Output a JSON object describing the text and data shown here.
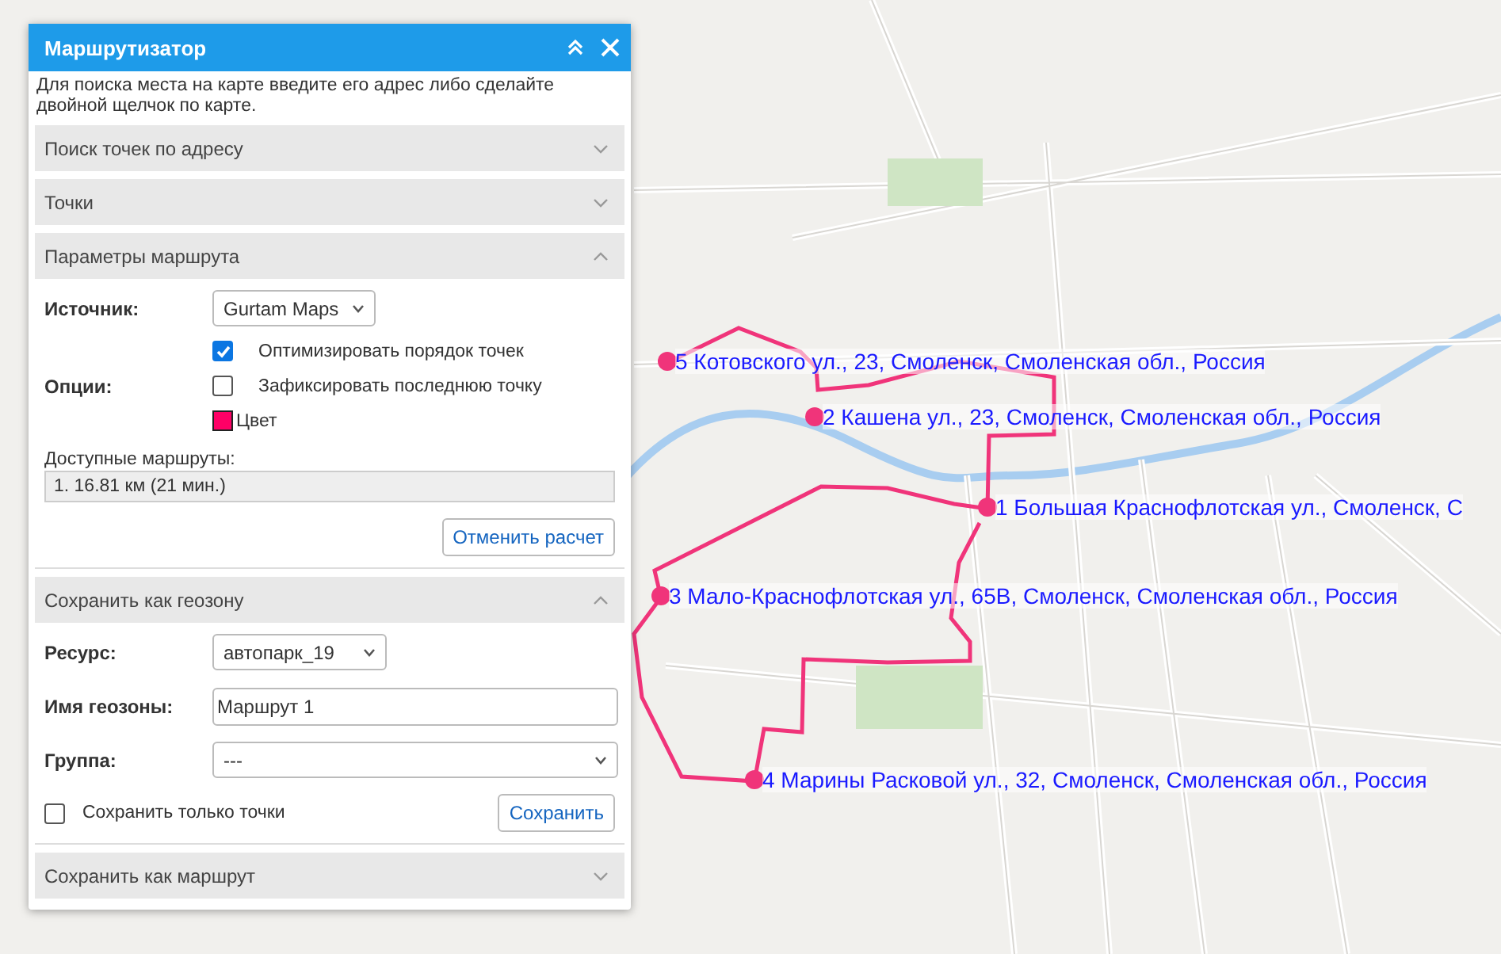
{
  "map": {
    "markers": [
      {
        "label": "5 Котовского ул., 23, Смоленск, Смоленская обл., Россия"
      },
      {
        "label": "2 Кашена ул., 23, Смоленск, Смоленская обл., Россия"
      },
      {
        "label": "1 Большая Краснофлотская ул., Смоленск, С"
      },
      {
        "label": "3 Мало-Краснофлотская ул., 65В, Смоленск, Смоленская обл., Россия"
      },
      {
        "label": "4 Марины Расковой ул., 32, Смоленск, Смоленская обл., Россия"
      }
    ]
  },
  "panel": {
    "title": "Маршрутизатор",
    "hint": "Для поиска места на карте введите его адрес либо сделайте двойной щелчок по карте.",
    "sections": [
      {
        "kind": "address_search",
        "title": "Поиск точек по адресу",
        "expanded": false
      },
      {
        "kind": "points",
        "title": "Точки",
        "expanded": false
      },
      {
        "kind": "route_params",
        "title": "Параметры маршрута",
        "expanded": true,
        "source_label": "Источник:",
        "source_value": "Gurtam Maps",
        "options_label": "Опции:",
        "options": [
          {
            "label": "Оптимизировать порядок точек",
            "checked": true
          },
          {
            "label": "Зафиксировать последнюю точку",
            "checked": false
          }
        ],
        "color_label": "Цвет",
        "color": "#ff0066",
        "routes_label": "Доступные маршруты:",
        "routes": [
          "1. 16.81 км (21 мин.)"
        ],
        "cancel_button": "Отменить расчет"
      },
      {
        "kind": "geofence",
        "title": "Сохранить как геозону",
        "expanded": true,
        "resource_label": "Ресурс:",
        "resource_value": "автопарк_19",
        "name_label": "Имя геозоны:",
        "name_value": "Маршрут 1",
        "group_label": "Группа:",
        "group_value": "---",
        "points_only": {
          "label": "Сохранить только точки",
          "checked": false
        },
        "save_button": "Сохранить"
      },
      {
        "kind": "route",
        "title": "Сохранить как маршрут",
        "expanded": false
      }
    ]
  }
}
